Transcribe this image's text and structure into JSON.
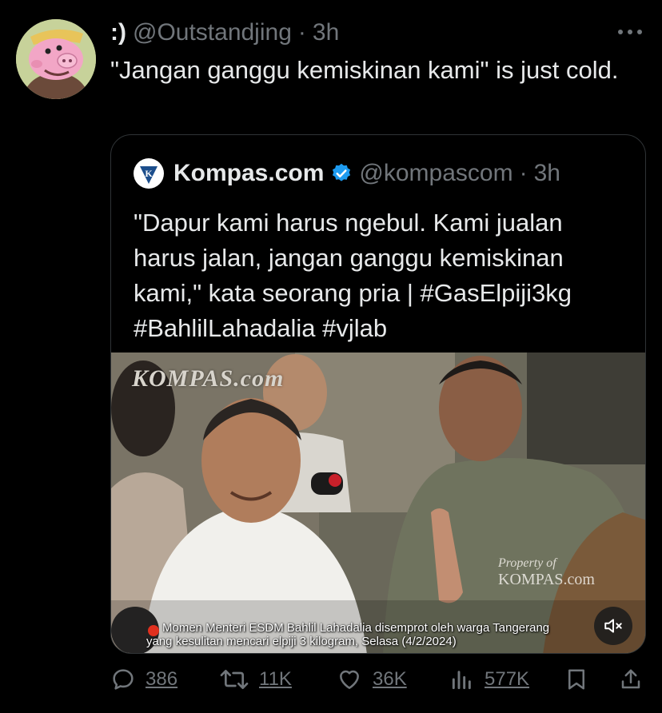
{
  "tweet": {
    "display_name": ":)",
    "handle": "@Outstandjing",
    "dot": "·",
    "time": "3h",
    "text": "\"Jangan ganggu kemiskinan kami\" is just cold.",
    "avatar_icon": "pig-cartoon-avatar",
    "more_icon": "more-dots-icon"
  },
  "quote": {
    "display_name": "Kompas.com",
    "verified_color": "#1d9bf0",
    "handle": "@kompascom",
    "dot": "·",
    "time": "3h",
    "text": "\"Dapur kami harus ngebul. Kami jualan harus jalan, jangan ganggu kemiskinan kami,\" kata seorang pria | #GasElpiji3kg #BahlilLahadalia #vjlab",
    "avatar_letter": "K",
    "media": {
      "watermark_top": "KOMPAS.com",
      "watermark_prop_line1": "Property of",
      "watermark_prop_line2": "KOMPAS.com",
      "caption_line1": "Momen Menteri ESDM Bahlil Lahadalia disemprot oleh warga Tangerang",
      "caption_line2": "yang kesulitan mencari elpiji 3 kilogram, Selasa (4/2/2024)",
      "mute_icon": "speaker-muted-icon"
    }
  },
  "actions": {
    "replies": "386",
    "retweets": "11K",
    "likes": "36K",
    "views": "577K",
    "colors": {
      "icon": "#71767b"
    }
  }
}
